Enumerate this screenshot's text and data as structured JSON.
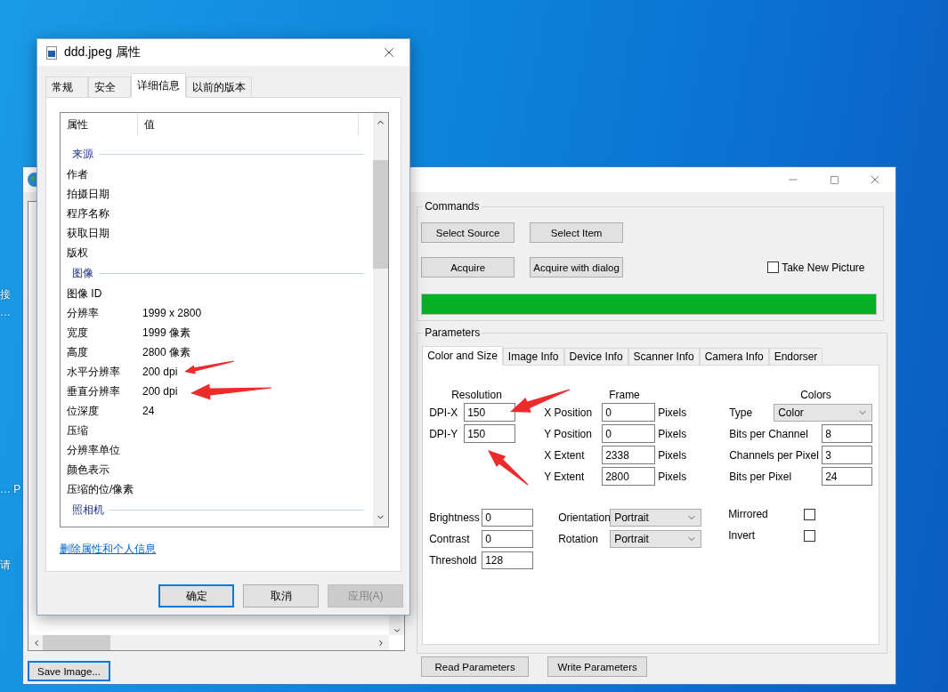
{
  "desktop_labels": [
    "接",
    "…",
    "… P",
    "请"
  ],
  "main_window": {
    "commands": {
      "title": "Commands",
      "buttons": [
        "Select Source",
        "Select Item",
        "Acquire",
        "Acquire with dialog"
      ],
      "take_new_picture": {
        "label": "Take New Picture",
        "checked": false
      },
      "progress": {
        "level": 1
      }
    },
    "parameters": {
      "title": "Parameters",
      "tabs": [
        {
          "label": "Color and Size",
          "selected": true
        },
        {
          "label": "Image Info",
          "selected": false
        },
        {
          "label": "Device Info",
          "selected": false
        },
        {
          "label": "Scanner Info",
          "selected": false
        },
        {
          "label": "Camera Info",
          "selected": false
        },
        {
          "label": "Endorser",
          "selected": false
        }
      ],
      "resolution": {
        "heading": "Resolution",
        "fields": [
          {
            "label": "DPI-X",
            "value": "150"
          },
          {
            "label": "DPI-Y",
            "value": "150"
          }
        ]
      },
      "frame": {
        "heading": "Frame",
        "fields": [
          {
            "label": "X Position",
            "value": "0",
            "unit": "Pixels"
          },
          {
            "label": "Y Position",
            "value": "0",
            "unit": "Pixels"
          },
          {
            "label": "X Extent",
            "value": "2338",
            "unit": "Pixels"
          },
          {
            "label": "Y Extent",
            "value": "2800",
            "unit": "Pixels"
          }
        ]
      },
      "colors": {
        "heading": "Colors",
        "fields": [
          {
            "kind": "select",
            "label": "Type",
            "value": "Color"
          },
          {
            "kind": "input",
            "label": "Bits per Channel",
            "value": "8"
          },
          {
            "kind": "input",
            "label": "Channels per Pixel",
            "value": "3"
          },
          {
            "kind": "input",
            "label": "Bits per Pixel",
            "value": "24"
          }
        ]
      },
      "adjustments": [
        {
          "label": "Brightness",
          "value": "0"
        },
        {
          "label": "Contrast",
          "value": "0"
        },
        {
          "label": "Threshold",
          "value": "128"
        }
      ],
      "orientation": [
        {
          "label": "Orientation",
          "value": "Portrait"
        },
        {
          "label": "Rotation",
          "value": "Portrait"
        }
      ],
      "flags": [
        {
          "label": "Mirrored",
          "checked": false
        },
        {
          "label": "Invert",
          "checked": false
        }
      ]
    },
    "parameter_buttons": [
      "Read Parameters",
      "Write Parameters"
    ],
    "save_button": "Save Image..."
  },
  "properties_dialog": {
    "title": "ddd.jpeg 属性",
    "tabs": [
      {
        "label": "常规",
        "selected": false
      },
      {
        "label": "安全",
        "selected": false
      },
      {
        "label": "详细信息",
        "selected": true
      },
      {
        "label": "以前的版本",
        "selected": false
      }
    ],
    "columns": [
      "属性",
      "值"
    ],
    "groups": [
      {
        "name": "来源",
        "rows": [
          {
            "property": "作者"
          },
          {
            "property": "拍摄日期"
          },
          {
            "property": "程序名称"
          },
          {
            "property": "获取日期"
          },
          {
            "property": "版权"
          }
        ]
      },
      {
        "name": "图像",
        "rows": [
          {
            "property": "图像 ID"
          },
          {
            "property": "分辨率",
            "value": "1999 x 2800"
          },
          {
            "property": "宽度",
            "value": "1999 像素"
          },
          {
            "property": "高度",
            "value": "2800 像素"
          },
          {
            "property": "水平分辨率",
            "value": "200 dpi"
          },
          {
            "property": "垂直分辨率",
            "value": "200 dpi"
          },
          {
            "property": "位深度",
            "value": "24"
          },
          {
            "property": "压缩"
          },
          {
            "property": "分辨率单位"
          },
          {
            "property": "颜色表示"
          },
          {
            "property": "压缩的位/像素"
          }
        ]
      },
      {
        "name": "照相机"
      }
    ],
    "link": "删除属性和个人信息",
    "buttons": [
      {
        "label": "确定",
        "default": true,
        "disabled": false
      },
      {
        "label": "取消",
        "default": false,
        "disabled": false
      },
      {
        "label": "应用(A)",
        "default": false,
        "disabled": true
      }
    ]
  }
}
